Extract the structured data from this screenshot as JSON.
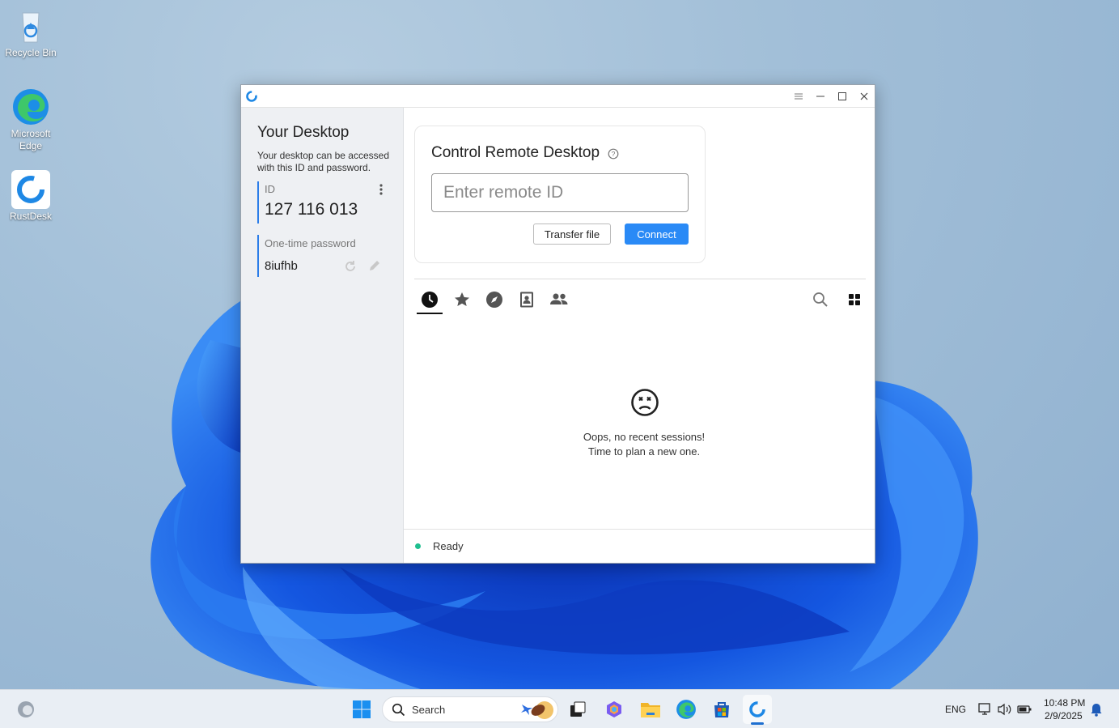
{
  "desktop": {
    "icons": [
      {
        "label": "Recycle Bin"
      },
      {
        "label": "Microsoft Edge"
      },
      {
        "label": "RustDesk"
      }
    ]
  },
  "window": {
    "controls": [
      "menu-icon",
      "minimize-icon",
      "maximize-icon",
      "close-icon"
    ]
  },
  "sidebar": {
    "title": "Your Desktop",
    "description": "Your desktop can be accessed with this ID and password.",
    "id_label": "ID",
    "id_value": "127 116 013",
    "password_label": "One-time password",
    "password_value": "8iufhb"
  },
  "control": {
    "title": "Control Remote Desktop",
    "input_placeholder": "Enter remote ID",
    "input_value": "",
    "transfer_label": "Transfer file",
    "connect_label": "Connect",
    "accent": "#2a8af6"
  },
  "tabs": [
    "recent-sessions",
    "favorites",
    "discovered",
    "address-book",
    "group"
  ],
  "empty_state": {
    "line1": "Oops, no recent sessions!",
    "line2": "Time to plan a new one."
  },
  "status": {
    "text": "Ready",
    "color": "#1fbf8f"
  },
  "taskbar": {
    "search_label": "Search",
    "language": "ENG",
    "time": "10:48 PM",
    "date": "2/9/2025"
  }
}
